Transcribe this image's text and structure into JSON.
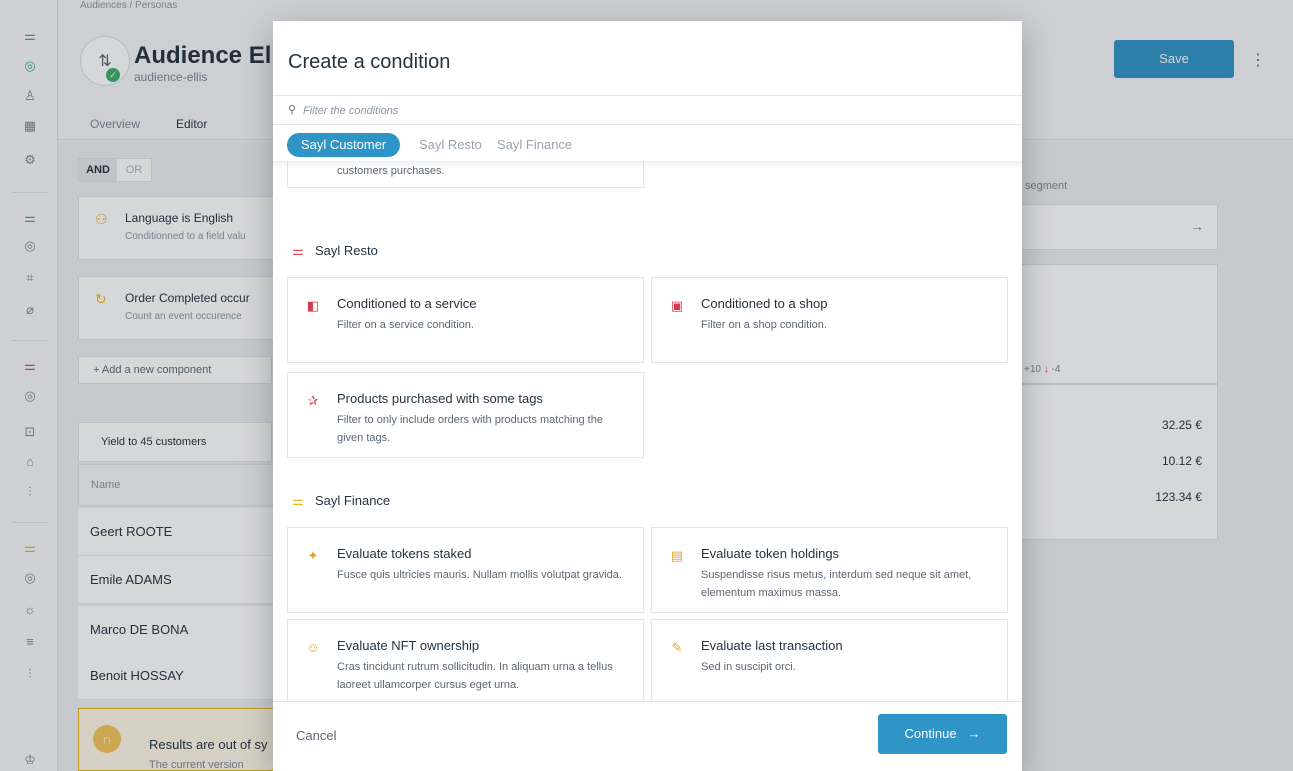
{
  "background": {
    "breadcrumb": "Audiences / Personas",
    "persona": {
      "title": "Audience Elli",
      "subtitle": "audience-ellis"
    },
    "save_label": "Save",
    "tabs": [
      {
        "label": "Overview"
      },
      {
        "label": "Editor"
      }
    ],
    "and_label": "AND",
    "or_label": "OR",
    "conditions": [
      {
        "title": "Language  is  English",
        "sub": "Conditionned to a field valu"
      },
      {
        "title": "Order Completed  occur",
        "sub": "Count an event occurence"
      }
    ],
    "add_component_label": "+  Add a new component",
    "yield_label": "Yield to 45 customers",
    "list_header": "Name",
    "people": [
      "Geert ROOTE",
      "Emile ADAMS",
      "Marco DE BONA",
      "Benoit HOSSAY"
    ],
    "warning": {
      "title": "Results are out of sy",
      "sub": "The current version"
    },
    "right": {
      "segment_label": "segment",
      "stat_up": "+10",
      "stat_down": "-4",
      "values": [
        "32.25 €",
        "10.12 €",
        "123.34 €"
      ]
    }
  },
  "modal": {
    "title": "Create a condition",
    "search_placeholder": "Filter the conditions",
    "pills": [
      {
        "label": "Sayl Customer",
        "active": true
      },
      {
        "label": "Sayl Resto",
        "active": false
      },
      {
        "label": "Sayl Finance",
        "active": false
      }
    ],
    "partial_card_text": "customers purchases.",
    "sections": [
      {
        "title": "Sayl Resto",
        "icon": "sayl-resto-icon",
        "color": "#e0485a",
        "options": [
          {
            "title": "Conditioned to a service",
            "desc": "Filter on a service condition.",
            "icon": "service-icon"
          },
          {
            "title": "Conditioned to a shop",
            "desc": "Filter on a shop condition.",
            "icon": "shop-icon"
          },
          {
            "title": "Products purchased with some tags",
            "desc": "Filter to only include orders with products matching the given tags.",
            "icon": "tag-icon"
          }
        ]
      },
      {
        "title": "Sayl Finance",
        "icon": "sayl-finance-icon",
        "color": "#e9b61b",
        "options": [
          {
            "title": "Evaluate tokens staked",
            "desc": "Fusce quis ultricies mauris. Nullam mollis volutpat gravida.",
            "icon": "sparkle-icon"
          },
          {
            "title": "Evaluate token holdings",
            "desc": "Suspendisse risus metus, interdum sed neque sit amet, elementum maximus massa.",
            "icon": "wallet-icon"
          },
          {
            "title": "Evaluate NFT ownership",
            "desc": "Cras tincidunt rutrum sollicitudin. In aliquam urna a tellus laoreet ullamcorper cursus eget urna.",
            "icon": "nft-icon"
          },
          {
            "title": "Evaluate last transaction",
            "desc": "Sed in suscipit orci.",
            "icon": "pencil-icon"
          }
        ]
      }
    ],
    "cancel_label": "Cancel",
    "continue_label": "Continue",
    "accent_color": "#2f94c6"
  }
}
